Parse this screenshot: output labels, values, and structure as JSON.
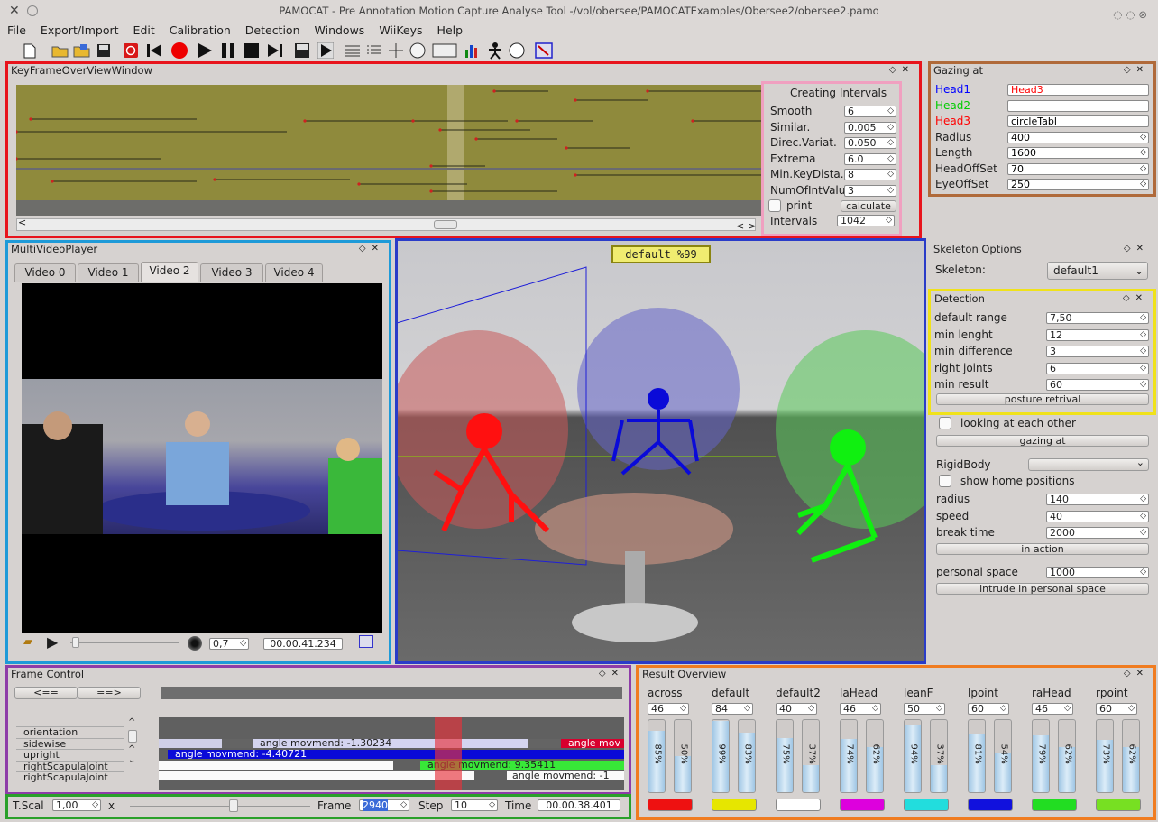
{
  "window": {
    "title": "PAMOCAT - Pre Annotation Motion Capture Analyse Tool -/vol/obersee/PAMOCATExamples/Obersee2/obersee2.pamo"
  },
  "menu": [
    "File",
    "Export/Import",
    "Edit",
    "Calibration",
    "Detection",
    "Windows",
    "WiiKeys",
    "Help"
  ],
  "keyframe": {
    "title": "KeyFrameOverViewWindow"
  },
  "intervals": {
    "title": "Creating Intervals",
    "fields": [
      {
        "label": "Smooth",
        "value": "6"
      },
      {
        "label": "Similar.",
        "value": "0.005"
      },
      {
        "label": "Direc.Variat.",
        "value": "0.050"
      },
      {
        "label": "Extrema",
        "value": "6.0"
      },
      {
        "label": "Min.KeyDista.",
        "value": "8"
      },
      {
        "label": "NumOfIntValu.",
        "value": "3"
      }
    ],
    "print": "print",
    "calculate": "calculate",
    "intervals_label": "Intervals",
    "intervals_value": "1042"
  },
  "gazing": {
    "title": "Gazing at",
    "rows": [
      {
        "label": "Head1",
        "value": "Head3",
        "color": "#0000ff",
        "vcolor": "#ff0000"
      },
      {
        "label": "Head2",
        "value": "",
        "color": "#00cc00",
        "vcolor": "#000"
      },
      {
        "label": "Head3",
        "value": "circleTabl",
        "color": "#ff0000",
        "vcolor": "#000"
      },
      {
        "label": "Radius",
        "value": "400",
        "color": "#222",
        "vcolor": "#000"
      },
      {
        "label": "Length",
        "value": "1600",
        "color": "#222",
        "vcolor": "#000"
      },
      {
        "label": "HeadOffSet",
        "value": "70",
        "color": "#222",
        "vcolor": "#000"
      },
      {
        "label": "EyeOffSet",
        "value": "250",
        "color": "#222",
        "vcolor": "#000"
      }
    ]
  },
  "multivideo": {
    "title": "MultiVideoPlayer",
    "tabs": [
      "Video 0",
      "Video 1",
      "Video 2",
      "Video 3",
      "Video 4"
    ],
    "active": 2,
    "speed": "0,7",
    "time": "00.00.41.234"
  },
  "scene": {
    "label": "default %99"
  },
  "skeleton": {
    "title": "Skeleton Options",
    "skeleton_label": "Skeleton:",
    "skeleton_value": "default1"
  },
  "detection": {
    "title": "Detection",
    "fields": [
      {
        "label": "default range",
        "value": "7,50"
      },
      {
        "label": "min lenght",
        "value": "12"
      },
      {
        "label": "min difference",
        "value": "3"
      },
      {
        "label": "right joints",
        "value": "6"
      },
      {
        "label": "min result",
        "value": "60"
      }
    ],
    "button": "posture retrival"
  },
  "gaze_opts": {
    "looking": "looking at each other",
    "gazing_btn": "gazing at"
  },
  "rigid": {
    "label": "RigidBody",
    "show_home": "show home positions",
    "fields": [
      {
        "label": "radius",
        "value": "140"
      },
      {
        "label": "speed",
        "value": "40"
      },
      {
        "label": "break time",
        "value": "2000"
      }
    ],
    "in_action": "in action",
    "personal_label": "personal space",
    "personal_value": "1000",
    "intrude": "intrude in personal space"
  },
  "frame_control": {
    "title": "Frame Control",
    "back": "<==",
    "fwd": "==>",
    "rows": [
      "orientation",
      "sidewise",
      "upright",
      "rightScapulaJoint",
      "rightScapulaJoint"
    ],
    "bars": [
      "angle movmend: -1.30234",
      "angle mov",
      "angle movmend: -4.40721",
      "angle movmend: 9.35411",
      "angle movmend: -1"
    ]
  },
  "bottom": {
    "tscal_label": "T.Scal",
    "tscal_value": "1,00",
    "x_label": "x",
    "frame_label": "Frame",
    "frame_value": "2940",
    "step_label": "Step",
    "step_value": "10",
    "time_label": "Time",
    "time_value": "00.00.38.401"
  },
  "result": {
    "title": "Result Overview",
    "cols": [
      {
        "name": "across",
        "value": "46",
        "p1": 85,
        "p2": 50,
        "color": "#ee1111"
      },
      {
        "name": "default",
        "value": "84",
        "p1": 99,
        "p2": 83,
        "color": "#e6e600"
      },
      {
        "name": "default2",
        "value": "40",
        "p1": 75,
        "p2": 37,
        "color": "#ffffff"
      },
      {
        "name": "laHead",
        "value": "46",
        "p1": 74,
        "p2": 62,
        "color": "#dd00dd"
      },
      {
        "name": "leanF",
        "value": "50",
        "p1": 94,
        "p2": 37,
        "color": "#22dddd"
      },
      {
        "name": "lpoint",
        "value": "60",
        "p1": 81,
        "p2": 54,
        "color": "#1111dd"
      },
      {
        "name": "raHead",
        "value": "46",
        "p1": 79,
        "p2": 62,
        "color": "#22dd22"
      },
      {
        "name": "rpoint",
        "value": "60",
        "p1": 73,
        "p2": 62,
        "color": "#77e022"
      }
    ]
  },
  "highlight_colors": {
    "keyframe": "#e8141c",
    "gazing": "#b06a3a",
    "multivideo": "#1e9ad8",
    "scene": "#2a3cc8",
    "detection": "#f0e21a",
    "frame_control": "#8e3ca8",
    "bottom": "#2aa02a",
    "result": "#f07c20",
    "intervals": "#f0a0c0"
  }
}
